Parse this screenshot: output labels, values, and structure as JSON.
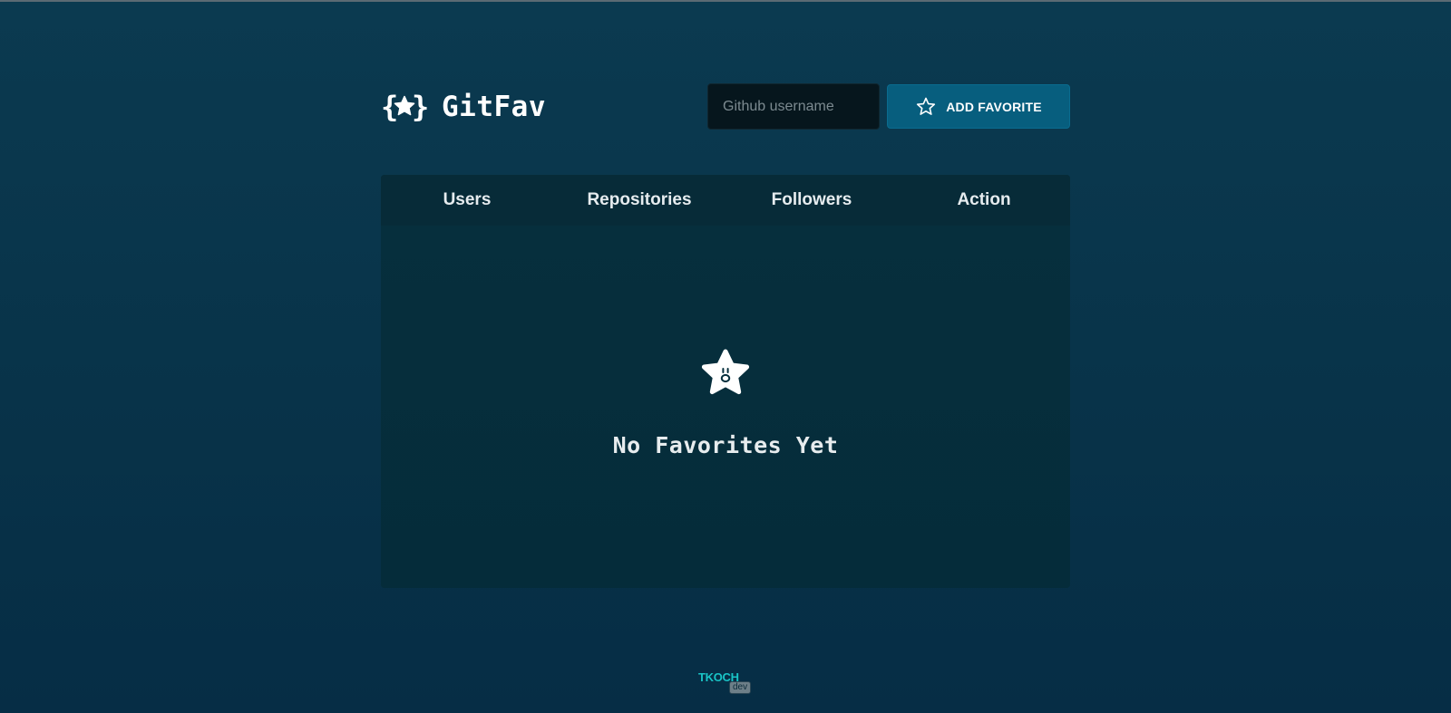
{
  "app": {
    "logo_icon": "star-in-braces-icon",
    "title": "GitFav"
  },
  "search": {
    "placeholder": "Github username",
    "value": ""
  },
  "add_button": {
    "icon": "star-outline-icon",
    "label": "ADD FAVORITE"
  },
  "table": {
    "columns": [
      "Users",
      "Repositories",
      "Followers",
      "Action"
    ]
  },
  "empty_state": {
    "icon": "surprised-star-icon",
    "message": "No Favorites Yet"
  },
  "footer": {
    "brand": "TKOCH",
    "brand_sub": "dev"
  },
  "colors": {
    "background": "#083349",
    "accent_button": "#075e7e",
    "input_background": "#06161d",
    "table_header": "#072b38",
    "table_body": "#052d3b",
    "footer_brand": "#19c4c6"
  }
}
